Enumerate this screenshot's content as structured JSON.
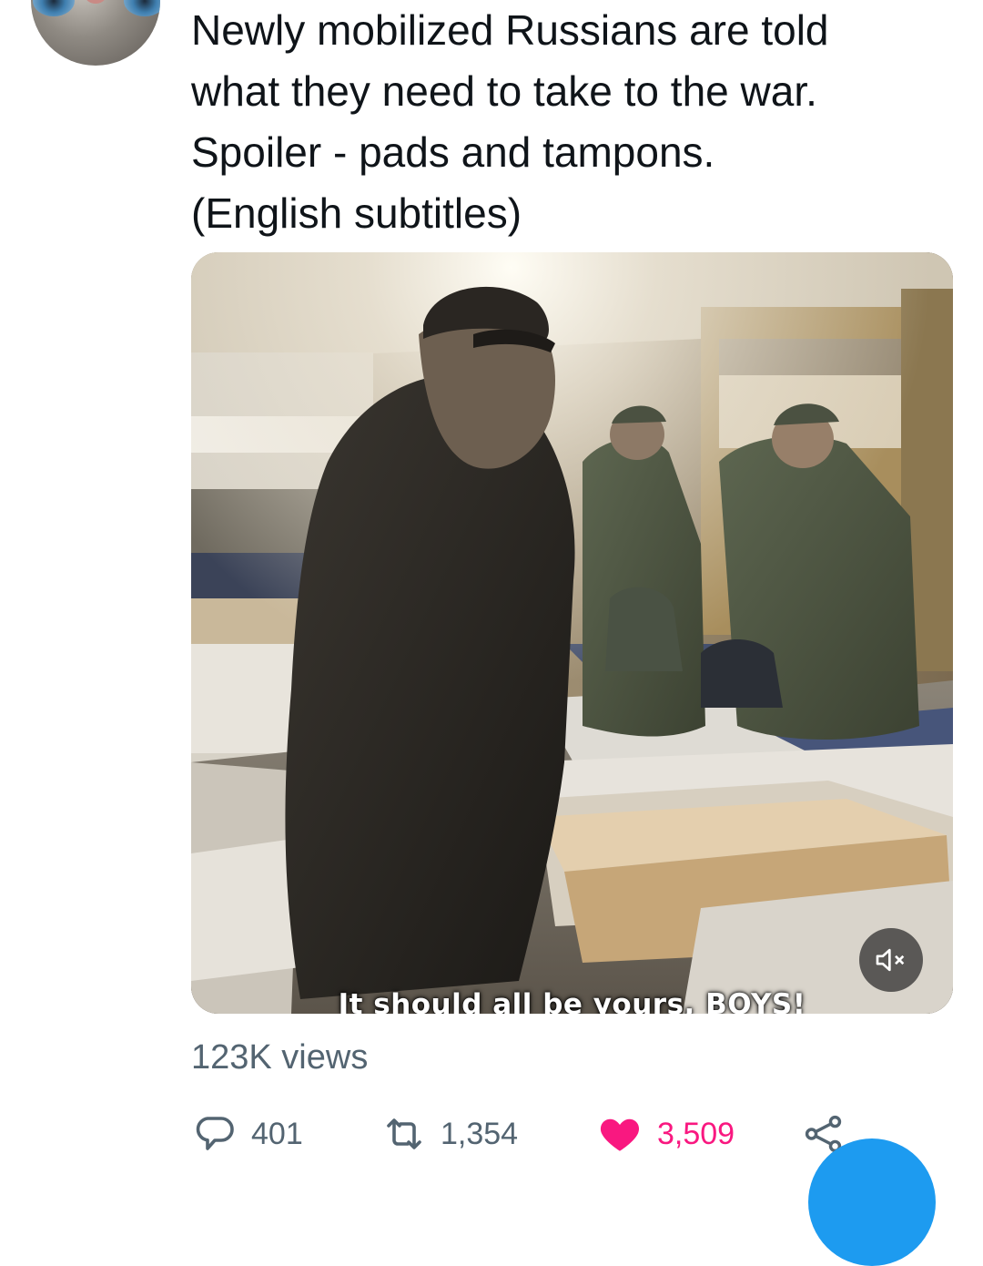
{
  "tweet": {
    "text": "Newly mobilized Russians are told\nwhat they need to take to the war.\nSpoiler - pads and tampons.\n(English subtitles)",
    "views": "123K views"
  },
  "media": {
    "subtitle": "It should all be yours, BOYS!",
    "mute_icon": "volume-muted-icon"
  },
  "actions": {
    "reply_count": "401",
    "retweet_count": "1,354",
    "like_count": "3,509",
    "reply_icon": "reply-icon",
    "retweet_icon": "retweet-icon",
    "like_icon": "heart-filled-icon",
    "share_icon": "share-icon"
  },
  "colors": {
    "text": "#0f1419",
    "secondary": "#536471",
    "like": "#f91880",
    "accent": "#1d9bf0"
  }
}
